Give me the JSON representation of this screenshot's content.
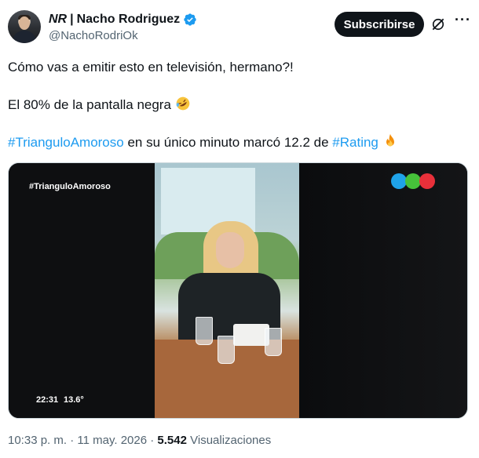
{
  "author": {
    "prefix": "NR",
    "separator": "|",
    "name": "Nacho Rodriguez",
    "handle": "@NachoRodriOk",
    "verified_color": "#1d9bf0"
  },
  "actions": {
    "subscribe_label": "Subscribirse",
    "more_label": "···"
  },
  "tweet": {
    "line1": "Cómo vas a emitir esto en televisión, hermano?!",
    "line2_text": "El 80% de la pantalla negra",
    "line2_emoji": "rolling-on-floor-laughing-icon",
    "line3_hashtag1": "#TrianguloAmoroso",
    "line3_middle": " en su único minuto marcó 12.2 de ",
    "line3_hashtag2": "#Rating",
    "line3_emoji": "fire-icon"
  },
  "media": {
    "overlay_hashtag": "#TrianguloAmoroso",
    "overlay_time": "22:31",
    "overlay_temp": "13.6°",
    "logo_colors": [
      "#1fa2e8",
      "#46c13a",
      "#e8303a"
    ]
  },
  "meta": {
    "time": "10:33 p. m.",
    "dot1": "·",
    "date": "11 may. 2026",
    "dot2": "·",
    "views_count": "5.542",
    "views_label": "Visualizaciones"
  },
  "colors": {
    "link": "#1d9bf0",
    "text": "#0f1419",
    "muted": "#536471"
  }
}
